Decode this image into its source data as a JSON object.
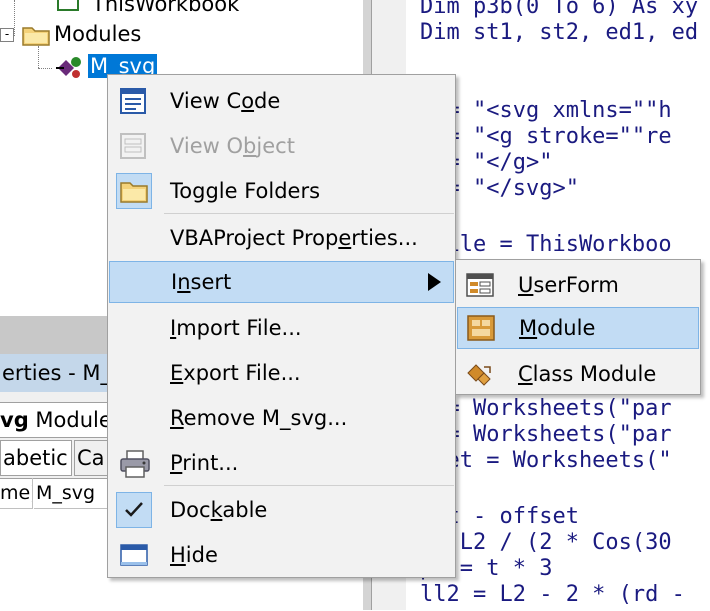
{
  "tree": {
    "this_workbook": "ThisWorkbook",
    "modules": "Modules",
    "module_item": "M_svg",
    "expander": "-"
  },
  "properties": {
    "title": "erties - M_s",
    "combo_bold": "vg",
    "combo_rest": " Module",
    "tab_alphabetic": "abetic",
    "tab_categorized": "Ca",
    "grid_name": "me)",
    "grid_value": "M_svg"
  },
  "code": {
    "lines": [
      "Dim p3b(0 To 6) As xy",
      "Dim st1, st2, ed1, ed",
      "",
      "",
      "1 = \"<svg xmlns=\"\"h",
      "2 = \"<g stroke=\"\"re",
      "1 = \"</g>\"",
      "2 = \"</svg>\"",
      "",
      "gfile = ThisWorkboo",
      "",
      "",
      "",
      "",
      "",
      "d = Worksheets(\"par",
      "n = Worksheets(\"par",
      "fset = Worksheets(\"",
      "",
      "= t - offset",
      " = L2 / (2 * Cos(30",
      "pw = t * 3",
      "ll2 = L2 - 2 * (rd -"
    ]
  },
  "menu": {
    "items": [
      {
        "pre": "View C",
        "acc": "o",
        "post": "de"
      },
      {
        "pre": "View O",
        "acc": "b",
        "post": "ject"
      },
      {
        "pre": "Toggle Folders",
        "acc": "",
        "post": ""
      },
      {
        "pre": "VBAProject Prop",
        "acc": "e",
        "post": "rties..."
      },
      {
        "pre": "I",
        "acc": "n",
        "post": "sert"
      },
      {
        "pre": "",
        "acc": "I",
        "post": "mport File..."
      },
      {
        "pre": "",
        "acc": "E",
        "post": "xport File..."
      },
      {
        "pre": "",
        "acc": "R",
        "post": "emove M_svg..."
      },
      {
        "pre": "",
        "acc": "P",
        "post": "rint..."
      },
      {
        "pre": "Doc",
        "acc": "k",
        "post": "able"
      },
      {
        "pre": "",
        "acc": "H",
        "post": "ide"
      }
    ]
  },
  "submenu": {
    "items": [
      {
        "pre": "",
        "acc": "U",
        "post": "serForm"
      },
      {
        "pre": "",
        "acc": "M",
        "post": "odule"
      },
      {
        "pre": "",
        "acc": "C",
        "post": "lass Module"
      }
    ]
  },
  "colors": {
    "highlight": "#c2dcf4",
    "highlight_border": "#7eb4e6",
    "code_text": "#1a1a80",
    "selection": "#0078d7"
  }
}
